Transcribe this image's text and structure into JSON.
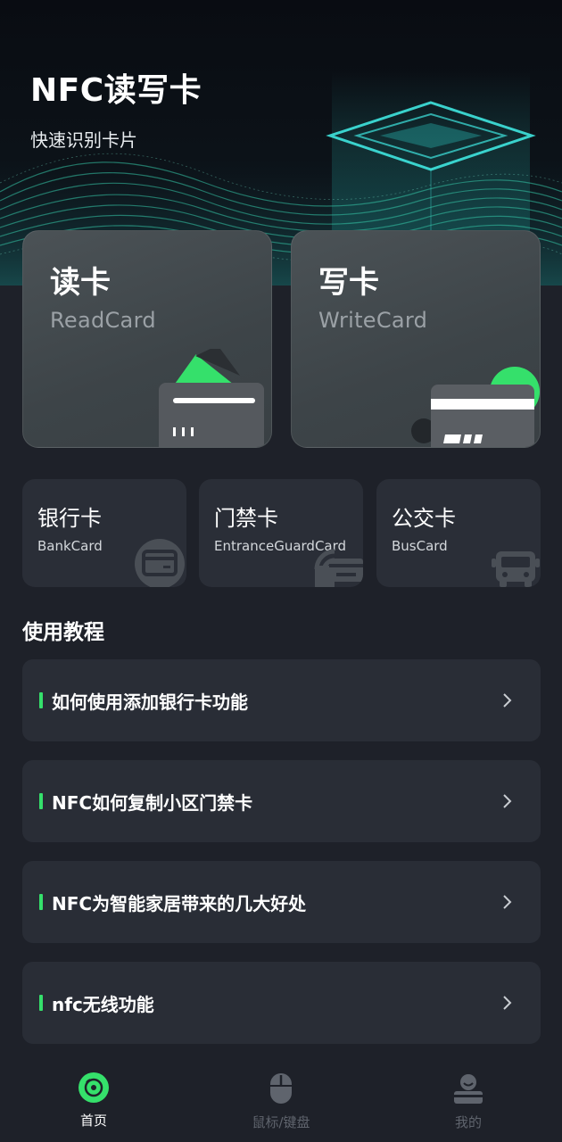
{
  "hero": {
    "title": "NFC读写卡",
    "subtitle": "快速识别卡片"
  },
  "main_cards": [
    {
      "title": "读卡",
      "subtitle": "ReadCard",
      "icon": "read-card-icon"
    },
    {
      "title": "写卡",
      "subtitle": "WriteCard",
      "icon": "write-card-icon"
    }
  ],
  "card_types": [
    {
      "title": "银行卡",
      "subtitle": "BankCard",
      "icon": "bank-card-icon"
    },
    {
      "title": "门禁卡",
      "subtitle": "EntranceGuardCard",
      "icon": "access-card-icon"
    },
    {
      "title": "公交卡",
      "subtitle": "BusCard",
      "icon": "bus-icon"
    }
  ],
  "tutorials": {
    "title": "使用教程",
    "items": [
      "如何使用添加银行卡功能",
      "NFC如何复制小区门禁卡",
      "NFC为智能家居带来的几大好处",
      "nfc无线功能"
    ]
  },
  "bottom_nav": {
    "items": [
      {
        "label": "首页",
        "icon": "home-disc-icon",
        "active": true
      },
      {
        "label": "鼠标/键盘",
        "icon": "mouse-icon",
        "active": false
      },
      {
        "label": "我的",
        "icon": "user-icon",
        "active": false
      }
    ]
  },
  "colors": {
    "accent": "#35e06b",
    "background": "#1e2129",
    "card": "#292d36",
    "inactive": "#5f646d"
  }
}
